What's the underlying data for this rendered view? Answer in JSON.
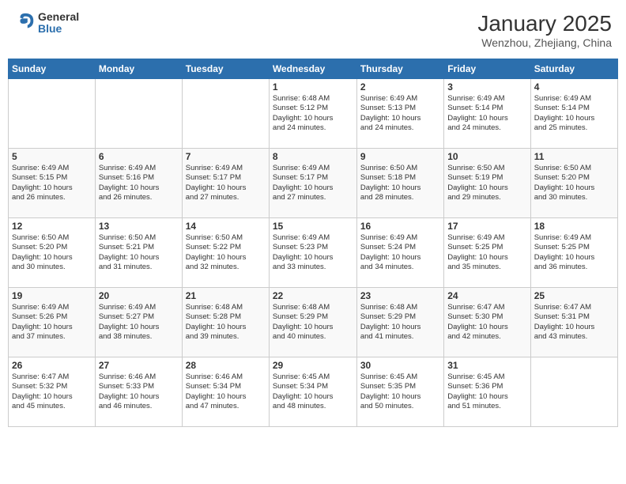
{
  "header": {
    "logo_general": "General",
    "logo_blue": "Blue",
    "month_year": "January 2025",
    "location": "Wenzhou, Zhejiang, China"
  },
  "days_of_week": [
    "Sunday",
    "Monday",
    "Tuesday",
    "Wednesday",
    "Thursday",
    "Friday",
    "Saturday"
  ],
  "weeks": [
    [
      {
        "day": "",
        "info": ""
      },
      {
        "day": "",
        "info": ""
      },
      {
        "day": "",
        "info": ""
      },
      {
        "day": "1",
        "info": "Sunrise: 6:48 AM\nSunset: 5:12 PM\nDaylight: 10 hours\nand 24 minutes."
      },
      {
        "day": "2",
        "info": "Sunrise: 6:49 AM\nSunset: 5:13 PM\nDaylight: 10 hours\nand 24 minutes."
      },
      {
        "day": "3",
        "info": "Sunrise: 6:49 AM\nSunset: 5:14 PM\nDaylight: 10 hours\nand 24 minutes."
      },
      {
        "day": "4",
        "info": "Sunrise: 6:49 AM\nSunset: 5:14 PM\nDaylight: 10 hours\nand 25 minutes."
      }
    ],
    [
      {
        "day": "5",
        "info": "Sunrise: 6:49 AM\nSunset: 5:15 PM\nDaylight: 10 hours\nand 26 minutes."
      },
      {
        "day": "6",
        "info": "Sunrise: 6:49 AM\nSunset: 5:16 PM\nDaylight: 10 hours\nand 26 minutes."
      },
      {
        "day": "7",
        "info": "Sunrise: 6:49 AM\nSunset: 5:17 PM\nDaylight: 10 hours\nand 27 minutes."
      },
      {
        "day": "8",
        "info": "Sunrise: 6:49 AM\nSunset: 5:17 PM\nDaylight: 10 hours\nand 27 minutes."
      },
      {
        "day": "9",
        "info": "Sunrise: 6:50 AM\nSunset: 5:18 PM\nDaylight: 10 hours\nand 28 minutes."
      },
      {
        "day": "10",
        "info": "Sunrise: 6:50 AM\nSunset: 5:19 PM\nDaylight: 10 hours\nand 29 minutes."
      },
      {
        "day": "11",
        "info": "Sunrise: 6:50 AM\nSunset: 5:20 PM\nDaylight: 10 hours\nand 30 minutes."
      }
    ],
    [
      {
        "day": "12",
        "info": "Sunrise: 6:50 AM\nSunset: 5:20 PM\nDaylight: 10 hours\nand 30 minutes."
      },
      {
        "day": "13",
        "info": "Sunrise: 6:50 AM\nSunset: 5:21 PM\nDaylight: 10 hours\nand 31 minutes."
      },
      {
        "day": "14",
        "info": "Sunrise: 6:50 AM\nSunset: 5:22 PM\nDaylight: 10 hours\nand 32 minutes."
      },
      {
        "day": "15",
        "info": "Sunrise: 6:49 AM\nSunset: 5:23 PM\nDaylight: 10 hours\nand 33 minutes."
      },
      {
        "day": "16",
        "info": "Sunrise: 6:49 AM\nSunset: 5:24 PM\nDaylight: 10 hours\nand 34 minutes."
      },
      {
        "day": "17",
        "info": "Sunrise: 6:49 AM\nSunset: 5:25 PM\nDaylight: 10 hours\nand 35 minutes."
      },
      {
        "day": "18",
        "info": "Sunrise: 6:49 AM\nSunset: 5:25 PM\nDaylight: 10 hours\nand 36 minutes."
      }
    ],
    [
      {
        "day": "19",
        "info": "Sunrise: 6:49 AM\nSunset: 5:26 PM\nDaylight: 10 hours\nand 37 minutes."
      },
      {
        "day": "20",
        "info": "Sunrise: 6:49 AM\nSunset: 5:27 PM\nDaylight: 10 hours\nand 38 minutes."
      },
      {
        "day": "21",
        "info": "Sunrise: 6:48 AM\nSunset: 5:28 PM\nDaylight: 10 hours\nand 39 minutes."
      },
      {
        "day": "22",
        "info": "Sunrise: 6:48 AM\nSunset: 5:29 PM\nDaylight: 10 hours\nand 40 minutes."
      },
      {
        "day": "23",
        "info": "Sunrise: 6:48 AM\nSunset: 5:29 PM\nDaylight: 10 hours\nand 41 minutes."
      },
      {
        "day": "24",
        "info": "Sunrise: 6:47 AM\nSunset: 5:30 PM\nDaylight: 10 hours\nand 42 minutes."
      },
      {
        "day": "25",
        "info": "Sunrise: 6:47 AM\nSunset: 5:31 PM\nDaylight: 10 hours\nand 43 minutes."
      }
    ],
    [
      {
        "day": "26",
        "info": "Sunrise: 6:47 AM\nSunset: 5:32 PM\nDaylight: 10 hours\nand 45 minutes."
      },
      {
        "day": "27",
        "info": "Sunrise: 6:46 AM\nSunset: 5:33 PM\nDaylight: 10 hours\nand 46 minutes."
      },
      {
        "day": "28",
        "info": "Sunrise: 6:46 AM\nSunset: 5:34 PM\nDaylight: 10 hours\nand 47 minutes."
      },
      {
        "day": "29",
        "info": "Sunrise: 6:45 AM\nSunset: 5:34 PM\nDaylight: 10 hours\nand 48 minutes."
      },
      {
        "day": "30",
        "info": "Sunrise: 6:45 AM\nSunset: 5:35 PM\nDaylight: 10 hours\nand 50 minutes."
      },
      {
        "day": "31",
        "info": "Sunrise: 6:45 AM\nSunset: 5:36 PM\nDaylight: 10 hours\nand 51 minutes."
      },
      {
        "day": "",
        "info": ""
      }
    ]
  ]
}
